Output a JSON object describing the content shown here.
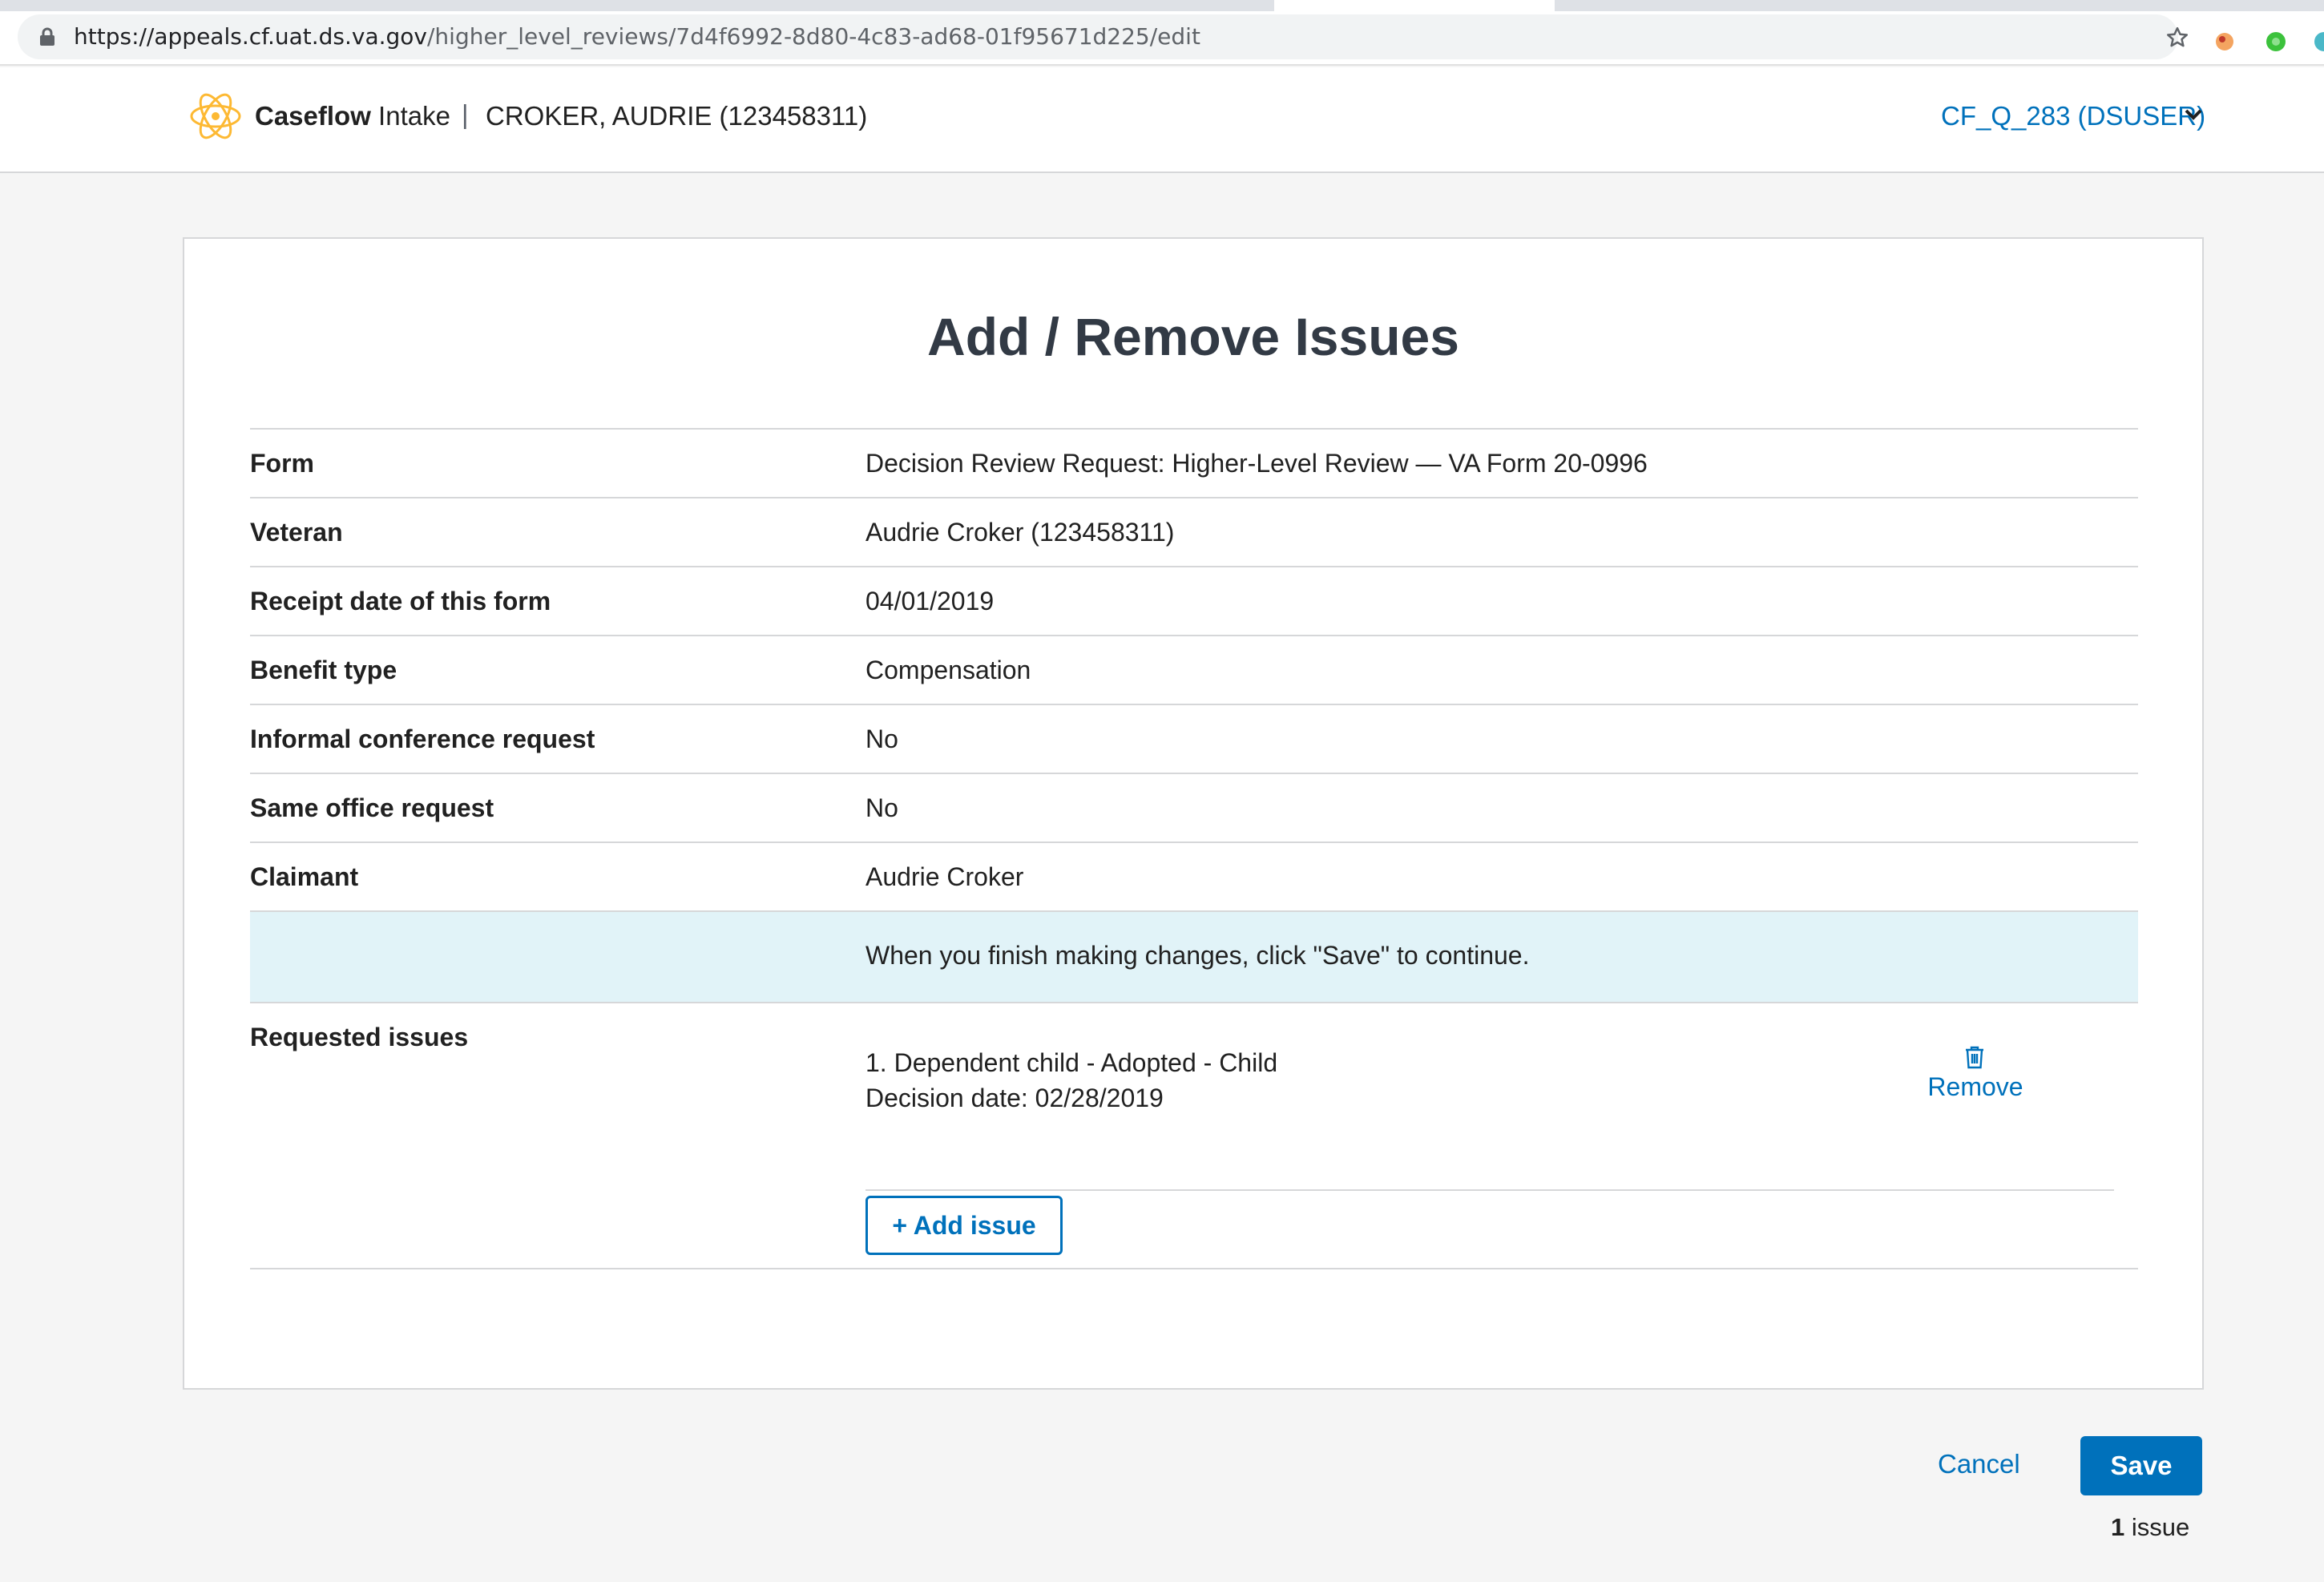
{
  "browser": {
    "url_host": "https://appeals.cf.uat.ds.va.gov",
    "url_path": "/higher_level_reviews/7d4f6992-8d80-4c83-ad68-01f95671d225/edit"
  },
  "header": {
    "brand": "Caseflow",
    "app_name": "Intake",
    "separator": "|",
    "veteran": "CROKER, AUDRIE (123458311)",
    "user": "CF_Q_283 (DSUSER)"
  },
  "page": {
    "title": "Add / Remove Issues"
  },
  "details": [
    {
      "label": "Form",
      "value": "Decision Review Request: Higher-Level Review — VA Form 20-0996"
    },
    {
      "label": "Veteran",
      "value": "Audrie Croker (123458311)"
    },
    {
      "label": "Receipt date of this form",
      "value": "04/01/2019"
    },
    {
      "label": "Benefit type",
      "value": "Compensation"
    },
    {
      "label": "Informal conference request",
      "value": "No"
    },
    {
      "label": "Same office request",
      "value": "No"
    },
    {
      "label": "Claimant",
      "value": "Audrie Croker"
    }
  ],
  "notice": "When you finish making changes, click \"Save\" to continue.",
  "requested_issues": {
    "label": "Requested issues",
    "items": [
      {
        "title": "1.  Dependent child - Adopted - Child",
        "decision_date": "Decision date: 02/28/2019",
        "remove_label": "Remove"
      }
    ],
    "add_label": "+ Add issue"
  },
  "footer": {
    "cancel_label": "Cancel",
    "save_label": "Save",
    "issue_count": "1",
    "issue_word": "issue"
  },
  "colors": {
    "link_blue": "#0071bb",
    "notice_bg": "#e1f3f8",
    "logo_gold": "#fdb933"
  }
}
